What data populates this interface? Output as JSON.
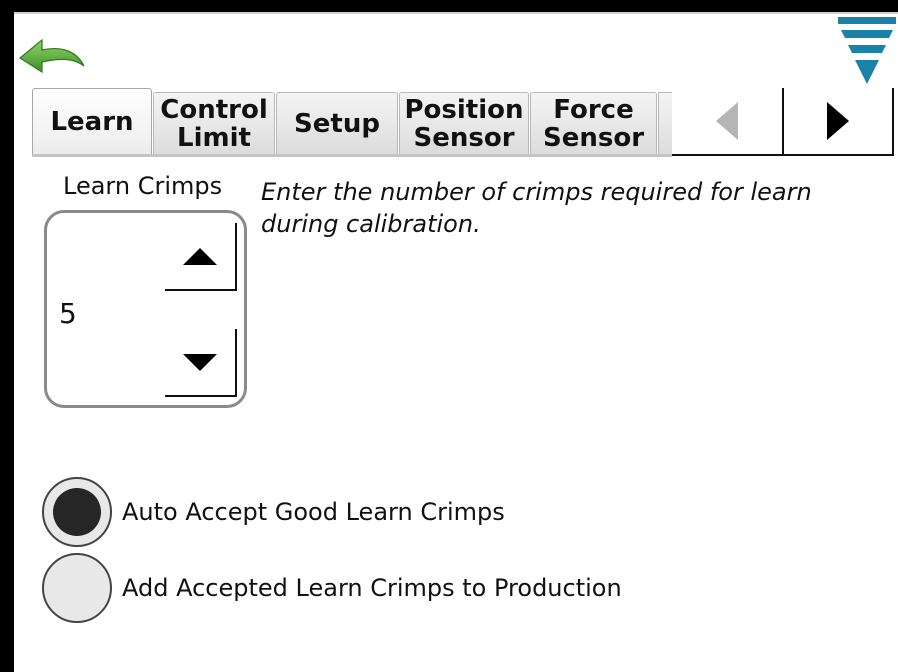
{
  "header": {
    "back_icon": "curved-back-arrow-icon",
    "menu_icon": "striped-triangle-menu-icon",
    "colors": {
      "back_arrow": "#5aa83a",
      "menu": "#1a82a8"
    }
  },
  "tabs": [
    {
      "label": "Learn",
      "active": true
    },
    {
      "label": "Control\nLimit",
      "active": false
    },
    {
      "label": "Setup",
      "active": false
    },
    {
      "label": "Position\nSensor",
      "active": false
    },
    {
      "label": "Force\nSensor",
      "active": false
    }
  ],
  "tab_nav": {
    "prev_icon": "triangle-left-icon",
    "next_icon": "triangle-right-icon"
  },
  "learn_crimps": {
    "label": "Learn Crimps",
    "value": "5",
    "description": "Enter the number of crimps required for learn during calibration.",
    "increment_icon": "triangle-up-icon",
    "decrement_icon": "triangle-down-icon"
  },
  "options": [
    {
      "label": "Auto Accept Good Learn Crimps",
      "selected": true
    },
    {
      "label": "Add Accepted Learn Crimps to Production",
      "selected": false
    }
  ]
}
